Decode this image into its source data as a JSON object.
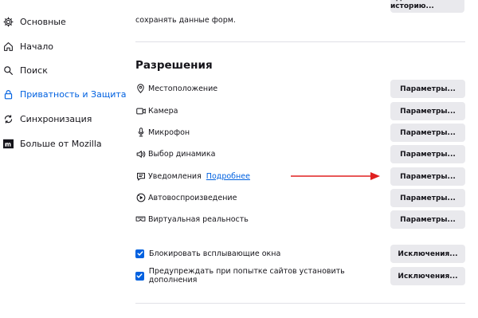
{
  "sidebar": {
    "items": [
      {
        "label": "Основные",
        "icon": "gear-icon"
      },
      {
        "label": "Начало",
        "icon": "home-icon"
      },
      {
        "label": "Поиск",
        "icon": "search-icon"
      },
      {
        "label": "Приватность и Защита",
        "icon": "lock-icon",
        "active": true
      },
      {
        "label": "Синхронизация",
        "icon": "sync-icon"
      },
      {
        "label": "Больше от Mozilla",
        "icon": "mozilla-icon"
      }
    ]
  },
  "main": {
    "top_text": "сохранять данные форм.",
    "top_button_label": "Удалить историю...",
    "permissions": {
      "title": "Разрешения",
      "learn_more": "Подробнее",
      "rows": [
        {
          "label": "Местоположение",
          "icon": "location-icon",
          "button": "Параметры..."
        },
        {
          "label": "Камера",
          "icon": "camera-icon",
          "button": "Параметры..."
        },
        {
          "label": "Микрофон",
          "icon": "microphone-icon",
          "button": "Параметры..."
        },
        {
          "label": "Выбор динамика",
          "icon": "speaker-icon",
          "button": "Параметры..."
        },
        {
          "label": "Уведомления",
          "icon": "notifications-icon",
          "button": "Параметры..."
        },
        {
          "label": "Автовоспроизведение",
          "icon": "autoplay-icon",
          "button": "Параметры..."
        },
        {
          "label": "Виртуальная реальность",
          "icon": "vr-icon",
          "button": "Параметры..."
        }
      ]
    },
    "checks": [
      {
        "label": "Блокировать всплывающие окна",
        "checked": true,
        "button": "Исключения..."
      },
      {
        "label": "Предупреждать при попытке сайтов установить дополнения",
        "checked": true,
        "button": "Исключения..."
      }
    ]
  },
  "colors": {
    "accent": "#0061e0",
    "button_bg": "#e9e9ed",
    "arrow": "#e02020"
  }
}
